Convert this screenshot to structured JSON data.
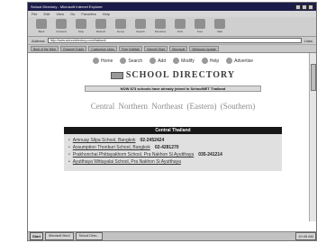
{
  "window": {
    "title": "School Directory - Microsoft Internet Explorer"
  },
  "menu": [
    "File",
    "Edit",
    "View",
    "Go",
    "Favorites",
    "Help"
  ],
  "toolbar": [
    "Back",
    "Forward",
    "Stop",
    "Refresh",
    "Home",
    "Search",
    "Favorites",
    "Print",
    "Font",
    "Mail"
  ],
  "address": {
    "label": "Address",
    "value": "http://www.schooldirectory.com/thailand/",
    "go": "Links"
  },
  "links": [
    "Best of the Web",
    "Channel Guide",
    "Customize Links",
    "Free HotMail",
    "Internet Start",
    "Microsoft",
    "Windows Update"
  ],
  "nav": [
    {
      "label": "Home",
      "icon": "home-icon"
    },
    {
      "label": "Search",
      "icon": "search-icon"
    },
    {
      "label": "Add",
      "icon": "add-icon"
    },
    {
      "label": "Modify",
      "icon": "edit-icon"
    },
    {
      "label": "Help",
      "icon": "help-icon"
    },
    {
      "label": "Advertise",
      "icon": "ad-icon"
    }
  ],
  "page": {
    "title": "SCHOOL DIRECTORY",
    "banner": "NOW 873 schools have already joined in SchoolNET Thailand",
    "regions": "Central  Northern  Northeast (Eastern)  (Southern)",
    "section": "Central Thailand"
  },
  "schools": [
    {
      "name": "Amnuay Silpa School, Bangkok",
      "phone": "02-2452424"
    },
    {
      "name": "Assumption Thonburi School, Bangkok",
      "phone": "02-4281270"
    },
    {
      "name": "Prakhonchai Phittayakhom School, Pra Nakhon Si Ayutthaya",
      "phone": "035-241214"
    },
    {
      "name": "Ayutthaya Wittayalai School, Pra Nakhon Si Ayutthaya",
      "phone": ""
    }
  ],
  "taskbar": {
    "start": "Start",
    "tasks": [
      "Microsoft Word",
      "School Direc..."
    ],
    "clock": "10:45 AM"
  }
}
